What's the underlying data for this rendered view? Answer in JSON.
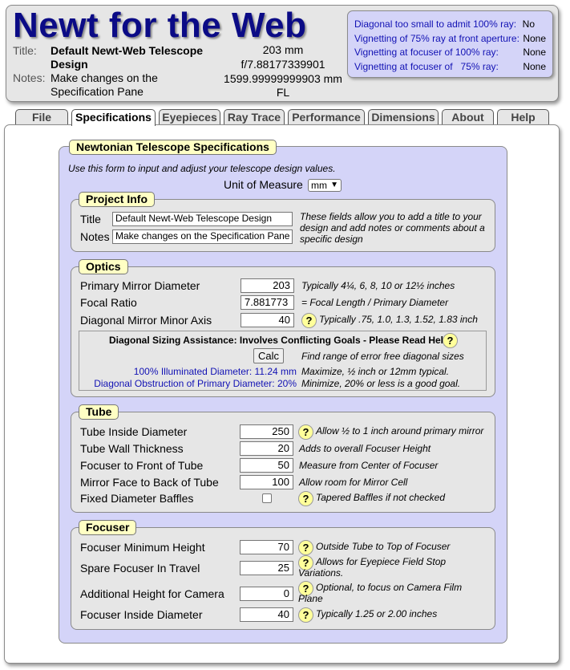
{
  "header": {
    "app_title": "Newt for the Web",
    "title_label": "Title:",
    "title_value": "Default Newt-Web Telescope Design",
    "notes_label": "Notes:",
    "notes_value": "Make changes on the Specification Pane",
    "aperture": "203 mm",
    "focal_ratio": "f/7.88177339901",
    "focal_length": "1599.99999999903 mm",
    "fl_label": "FL"
  },
  "status": [
    {
      "label": "Diagonal too small to admit 100% ray:",
      "value": "No"
    },
    {
      "label": "Vignetting of 75% ray at front aperture:",
      "value": "None"
    },
    {
      "label": "Vignetting at focuser of 100% ray:",
      "value": "None"
    },
    {
      "label": "Vignetting at focuser of   75% ray:",
      "value": "None"
    }
  ],
  "tabs": [
    "File",
    "Specifications",
    "Eyepieces",
    "Ray Trace",
    "Performance",
    "Dimensions",
    "About",
    "Help"
  ],
  "active_tab": "Specifications",
  "spec": {
    "legend": "Newtonian Telescope Specifications",
    "intro": "Use this form to input and adjust your telescope design values.",
    "unit_label": "Unit of Measure",
    "unit_value": "mm",
    "help_glyph": "?"
  },
  "project": {
    "legend": "Project Info",
    "title_label": "Title",
    "title_value": "Default Newt-Web Telescope Design",
    "notes_label": "Notes",
    "notes_value": "Make changes on the Specification Pane",
    "hint": "These fields allow you to add a title to your design and add notes or comments about a specific design"
  },
  "optics": {
    "legend": "Optics",
    "primary_label": "Primary Mirror Diameter",
    "primary_value": "203",
    "primary_hint": "Typically 4¼, 6, 8, 10 or 12½ inches",
    "ratio_label": "Focal Ratio",
    "ratio_value": "7.881773",
    "ratio_hint": "= Focal Length / Primary Diameter",
    "diag_label": "Diagonal Mirror Minor Axis",
    "diag_value": "40",
    "diag_hint": "Typically .75, 1.0, 1.3, 1.52, 1.83 inch",
    "assist_title": "Diagonal Sizing Assistance: Involves Conflicting Goals - Please Read Help",
    "calc_label": "Calc",
    "calc_hint": "Find range of error free diagonal sizes",
    "illum_text": "100% Illuminated Diameter: 11.24 mm",
    "illum_hint": "Maximize, ½ inch or 12mm typical.",
    "obstr_text": "Diagonal Obstruction of Primary Diameter: 20%",
    "obstr_hint": "Minimize, 20% or less is a good goal."
  },
  "tube": {
    "legend": "Tube",
    "rows": [
      {
        "label": "Tube Inside Diameter",
        "value": "250",
        "hint": "Allow ½ to 1 inch around primary mirror"
      },
      {
        "label": "Tube Wall Thickness",
        "value": "20",
        "hint": "Adds to overall Focuser Height"
      },
      {
        "label": "Focuser to Front of Tube",
        "value": "50",
        "hint": "Measure from Center of Focuser"
      },
      {
        "label": "Mirror Face to Back of Tube",
        "value": "100",
        "hint": "Allow room for Mirror Cell"
      },
      {
        "label": "Fixed Diameter Baffles",
        "value": "",
        "hint": "Tapered Baffles if not checked"
      }
    ]
  },
  "focuser": {
    "legend": "Focuser",
    "rows": [
      {
        "label": "Focuser Minimum Height",
        "value": "70",
        "hint": "Outside Tube to Top of Focuser"
      },
      {
        "label": "Spare Focuser In Travel",
        "value": "25",
        "hint": "Allows for Eyepiece Field Stop Variations."
      },
      {
        "label": "Additional Height for Camera",
        "value": "0",
        "hint": "Optional, to focus on Camera Film Plane"
      },
      {
        "label": "Focuser Inside Diameter",
        "value": "40",
        "hint": "Typically 1.25 or 2.00 inches"
      }
    ]
  }
}
